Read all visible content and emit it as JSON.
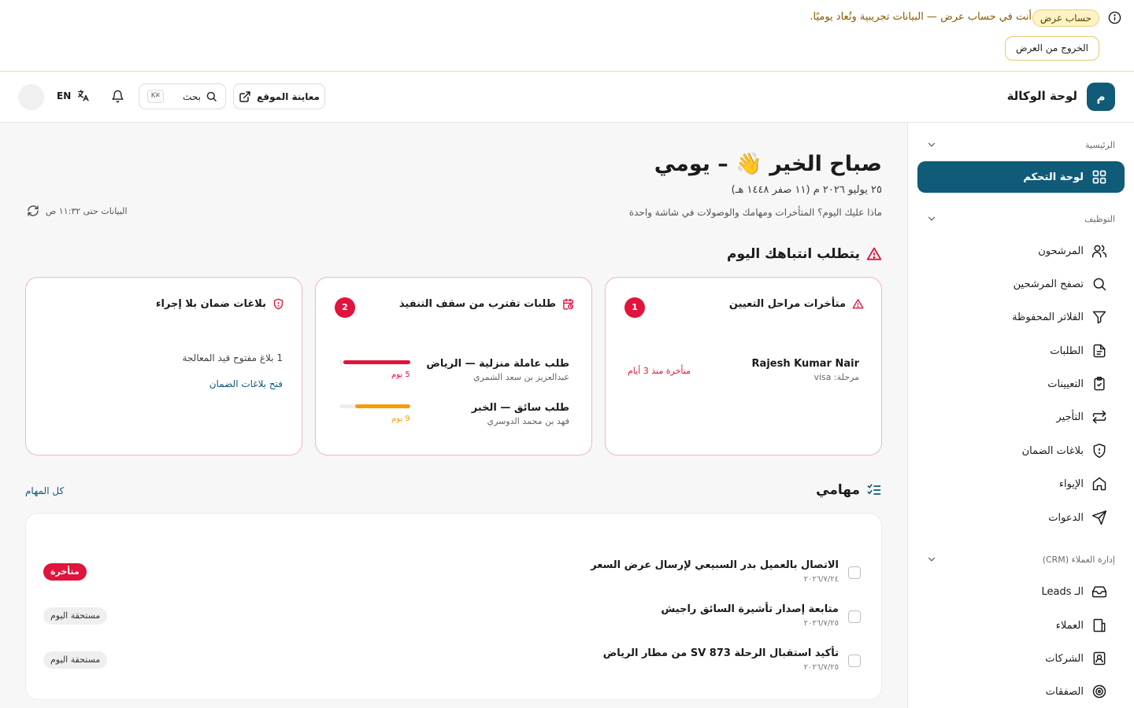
{
  "demo": {
    "badge": "حساب عرض",
    "message": "أنت في حساب عرض — البيانات تجريبية وتُعاد يوميًا.",
    "exit_label": "الخروج من العرض"
  },
  "header": {
    "logo_letter": "م",
    "title": "لوحة الوكالة",
    "preview_label": "معاينة الموقع",
    "search_label": "بحث",
    "search_shortcut": "⌘K",
    "lang_label": "EN"
  },
  "sidebar": {
    "groups": [
      {
        "label": "الرئيسية"
      },
      {
        "label": "التوظيف"
      },
      {
        "label": "إدارة العملاء (CRM)"
      }
    ],
    "items": [
      {
        "label": "لوحة التحكم",
        "icon": "grid-icon",
        "active": true
      },
      {
        "label": "المرشحون",
        "icon": "users-icon"
      },
      {
        "label": "تصفح المرشحين",
        "icon": "search-icon"
      },
      {
        "label": "الفلاتر المحفوظة",
        "icon": "filter-icon"
      },
      {
        "label": "الطلبات",
        "icon": "document-icon"
      },
      {
        "label": "التعيينات",
        "icon": "clipboard-check-icon"
      },
      {
        "label": "التأجير",
        "icon": "swap-icon"
      },
      {
        "label": "بلاغات الضمان",
        "icon": "shield-icon"
      },
      {
        "label": "الإيواء",
        "icon": "home-icon"
      },
      {
        "label": "الدعوات",
        "icon": "send-icon"
      },
      {
        "label": "الـ Leads",
        "icon": "inbox-icon"
      },
      {
        "label": "العملاء",
        "icon": "building-icon"
      },
      {
        "label": "الشركات",
        "icon": "badge-icon"
      },
      {
        "label": "الصفقات",
        "icon": "target-icon"
      }
    ]
  },
  "greeting": {
    "title": "صباح الخير 👋 – يومي",
    "date": "٢٥ يوليو ٢٠٢٦ م (١١ صفر ١٤٤٨ هـ)",
    "subtitle": "ماذا عليك اليوم؟ المتأخرات ومهامك والوصولات في شاشة واحدة",
    "updated": "البيانات حتى ١١:٣٢ ص"
  },
  "attention": {
    "title": "يتطلب انتباهك اليوم",
    "cards": [
      {
        "title": "متأخرات مراحل التعيين",
        "count": "1",
        "rows": [
          {
            "name": "Rajesh Kumar Nair",
            "sub": "مرحلة: visa",
            "status": "متأخرة منذ 3 أيام"
          }
        ]
      },
      {
        "title": "طلبات تقترب من سقف التنفيذ",
        "count": "2",
        "rows": [
          {
            "name": "طلب عاملة منزلية — الرياض",
            "sub": "عبدالعزيز بن سعد الشمري",
            "days": "5 يوم",
            "progress": 0.95,
            "color": "#e0143c"
          },
          {
            "name": "طلب سائق — الخبر",
            "sub": "فهد بن محمد الدوسري",
            "days": "9 يوم",
            "progress": 0.78,
            "color": "#f59e0b"
          }
        ]
      },
      {
        "title": "بلاغات ضمان بلا إجراء",
        "summary": "1 بلاغ مفتوح قيد المعالجة",
        "link": "فتح بلاغات الضمان"
      }
    ]
  },
  "tasks": {
    "title": "مهامي",
    "all_link": "كل المهام",
    "items": [
      {
        "title": "الاتصال بالعميل بدر السبيعي لإرسال عرض السعر",
        "date": "٢٠٢٦/٧/٢٤",
        "badge": "متأخرة",
        "late": true
      },
      {
        "title": "متابعة إصدار تأشيرة السائق راجيش",
        "date": "٢٠٢٦/٧/٢٥",
        "badge": "مستحقة اليوم",
        "late": false
      },
      {
        "title": "تأكيد استقبال الرحلة SV 873 من مطار الرياض",
        "date": "٢٠٢٦/٧/٢٥",
        "badge": "مستحقة اليوم",
        "late": false
      }
    ]
  },
  "colors": {
    "primary": "#0f5b78",
    "danger": "#e0143c",
    "warning": "#f59e0b",
    "demo": "#fdf3c4"
  }
}
